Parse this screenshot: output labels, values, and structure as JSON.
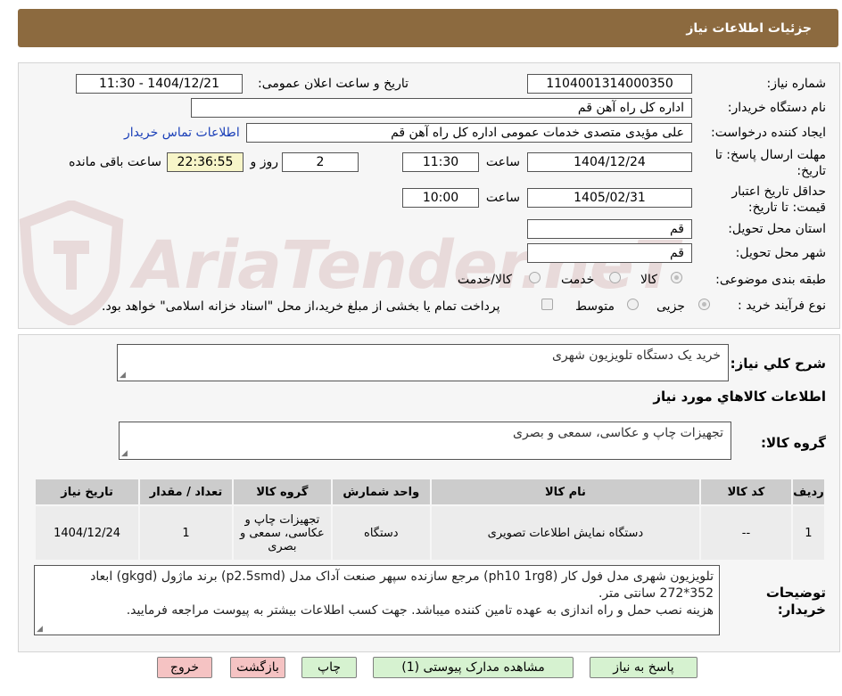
{
  "header": {
    "title": "جزئیات اطلاعات نیاز"
  },
  "watermark": {
    "text": "AriaTender.neT"
  },
  "form": {
    "need_number": {
      "label": "شماره نیاز:",
      "value": "1104001314000350"
    },
    "announce_datetime": {
      "label": "تاریخ و ساعت اعلان عمومی:",
      "value": "1404/12/21 - 11:30"
    },
    "buyer_org": {
      "label": "نام دستگاه خریدار:",
      "value": "اداره کل  راه آهن قم"
    },
    "requester": {
      "label": "ایجاد کننده درخواست:",
      "value": "علی مؤیدی متصدی خدمات عمومی اداره کل  راه آهن قم"
    },
    "contact_link": "اطلاعات تماس خریدار",
    "deadline": {
      "label_line1": "مهلت ارسال پاسخ: تا",
      "label_line2": "تاریخ:",
      "date": "1404/12/24",
      "time_label": "ساعت",
      "time": "11:30",
      "days": "2",
      "days_label": "روز و",
      "remaining_time": "22:36:55",
      "remaining_label": "ساعت باقی مانده"
    },
    "price_validity": {
      "label_line1": "حداقل تاریخ اعتبار",
      "label_line2": "قیمت: تا تاریخ:",
      "date": "1405/02/31",
      "time_label": "ساعت",
      "time": "10:00"
    },
    "delivery_province": {
      "label": "استان محل تحویل:",
      "value": "قم"
    },
    "delivery_city": {
      "label": "شهر محل تحویل:",
      "value": "قم"
    },
    "category": {
      "label": "طبقه بندی موضوعی:",
      "options": [
        "کالا",
        "خدمت",
        "کالا/خدمت"
      ],
      "selected": "کالا"
    },
    "purchase_type": {
      "label": "نوع فرآیند خرید :",
      "options": [
        "جزیی",
        "متوسط"
      ],
      "selected": "جزیی",
      "payment_note": "پرداخت تمام یا بخشی از مبلغ خرید،از محل \"اسناد خزانه اسلامی\" خواهد بود."
    }
  },
  "summary": {
    "label": "شرح کلي نياز:",
    "value": "خرید یک دستگاه تلویزیون شهری"
  },
  "goods_section": {
    "title": "اطلاعات کالاهاي مورد نياز"
  },
  "goods_group": {
    "label": "گروه کالا:",
    "value": "تجهیزات چاپ و عکاسی، سمعی و بصری"
  },
  "table": {
    "headers": [
      "ردیف",
      "کد کالا",
      "نام کالا",
      "واحد شمارش",
      "گروه کالا",
      "تعداد / مقدار",
      "تاریخ نیاز"
    ],
    "rows": [
      [
        "1",
        "--",
        "دستگاه نمایش اطلاعات تصویری",
        "دستگاه",
        "تجهیزات چاپ و عکاسی، سمعی و بصری",
        "1",
        "1404/12/24"
      ]
    ]
  },
  "buyer_notes": {
    "label_line1": "توضیحات",
    "label_line2": "خریدار:",
    "lines": [
      "تلویزیون شهری مدل فول کار (ph10 1rg8) مرجع سازنده سپهر صنعت آداک مدل (p2.5smd) برند ماژول (gkgd) ابعاد",
      "352*272 سانتی متر.",
      "هزینه نصب حمل و راه اندازی به عهده تامین کننده میباشد. جهت کسب اطلاعات بیشتر به پیوست مراجعه فرمایید."
    ]
  },
  "buttons": {
    "reply": "پاسخ به نیاز",
    "attachments": "مشاهده مدارک پیوستی (1)",
    "print": "چاپ",
    "back": "بازگشت",
    "exit": "خروج"
  }
}
